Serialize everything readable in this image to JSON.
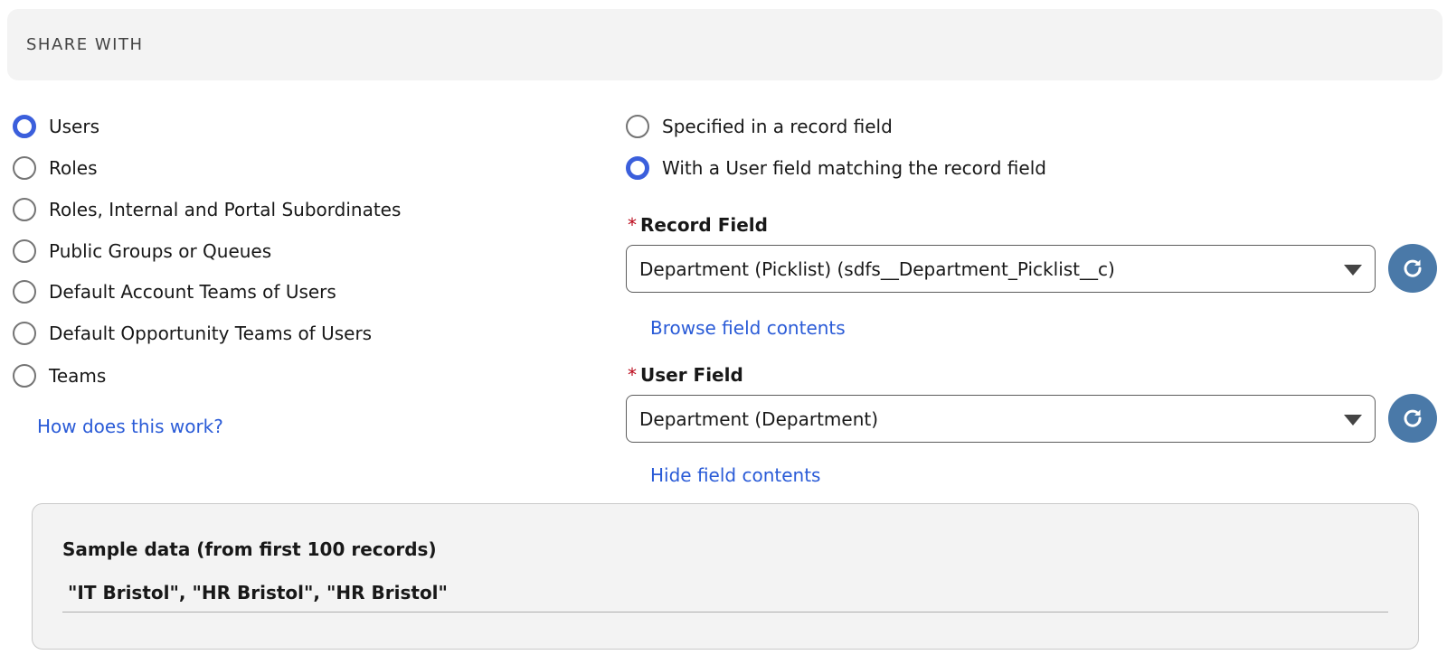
{
  "header": {
    "title": "SHARE WITH"
  },
  "share_options": [
    {
      "label": "Users",
      "checked": true
    },
    {
      "label": "Roles",
      "checked": false
    },
    {
      "label": "Roles, Internal and Portal Subordinates",
      "checked": false
    },
    {
      "label": "Public Groups or Queues",
      "checked": false
    },
    {
      "label": "Default Account Teams of Users",
      "checked": false
    },
    {
      "label": "Default Opportunity Teams of Users",
      "checked": false
    },
    {
      "label": "Teams",
      "checked": false
    }
  ],
  "help_link": "How does this work?",
  "user_options": [
    {
      "label": "Specified in a record field",
      "checked": false
    },
    {
      "label": "With a User field matching the record field",
      "checked": true
    }
  ],
  "record_field": {
    "required_mark": "*",
    "label": "Record Field",
    "value": "Department (Picklist) (sdfs__Department_Picklist__c)",
    "link": "Browse field contents"
  },
  "user_field": {
    "required_mark": "*",
    "label": "User Field",
    "value": "Department (Department)",
    "link": "Hide field contents"
  },
  "sample": {
    "title": "Sample data (from first 100 records)",
    "value": "\"IT Bristol\", \"HR Bristol\", \"HR Bristol\""
  },
  "icons": {
    "refresh": "refresh-icon",
    "dropdown": "chevron-down-icon"
  },
  "colors": {
    "accent": "#3b5fdc",
    "link": "#2a5bd7",
    "refresh_button": "#4a79a8",
    "required": "#ba0517"
  }
}
